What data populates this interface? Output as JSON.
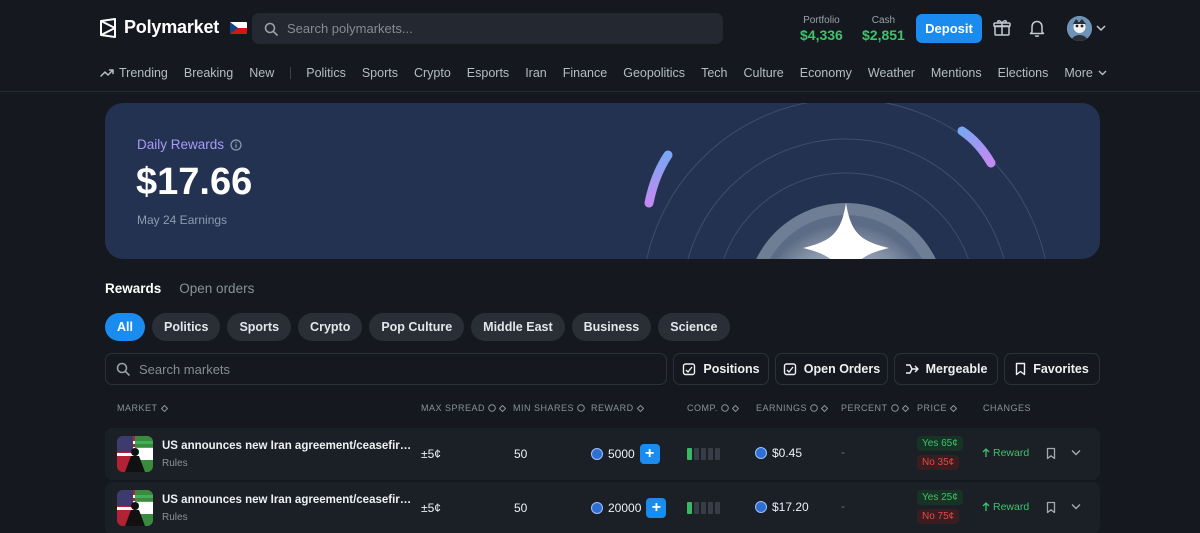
{
  "header": {
    "brand": "Polymarket",
    "search_placeholder": "Search polymarkets...",
    "portfolio_label": "Portfolio",
    "portfolio_value": "$4,336",
    "cash_label": "Cash",
    "cash_value": "$2,851",
    "deposit_label": "Deposit",
    "icons": [
      "polymarket-logo-icon",
      "czech-flag-icon",
      "search-icon",
      "gift-icon",
      "bell-icon",
      "avatar",
      "chevron-down-icon"
    ]
  },
  "nav": {
    "items": [
      "Trending",
      "Breaking",
      "New",
      "Politics",
      "Sports",
      "Crypto",
      "Esports",
      "Iran",
      "Finance",
      "Geopolitics",
      "Tech",
      "Culture",
      "Economy",
      "Weather",
      "Mentions",
      "Elections",
      "More"
    ]
  },
  "banner": {
    "title": "Daily Rewards",
    "amount": "$17.66",
    "subtitle": "May 24 Earnings"
  },
  "tabs": [
    "Rewards",
    "Open orders"
  ],
  "filters": [
    "All",
    "Politics",
    "Sports",
    "Crypto",
    "Pop Culture",
    "Middle East",
    "Business",
    "Science"
  ],
  "toolbar": {
    "search_placeholder": "Search markets",
    "positions": "Positions",
    "open_orders": "Open Orders",
    "mergeable": "Mergeable",
    "favorites": "Favorites"
  },
  "table": {
    "columns": [
      "MARKET",
      "MAX SPREAD",
      "MIN SHARES",
      "REWARD",
      "COMP.",
      "EARNINGS",
      "PERCENT",
      "PRICE",
      "CHANGES"
    ],
    "rows": [
      {
        "title": "US announces new Iran agreement/ceasefire ext...",
        "rules": "Rules",
        "max_spread": "±5¢",
        "min_shares": "50",
        "reward": "5000",
        "comp_level": 1,
        "earnings": "$0.45",
        "percent": "-",
        "yes": "Yes 65¢",
        "no": "No 35¢",
        "change": "Reward"
      },
      {
        "title": "US announces new Iran agreement/ceasefire ext...",
        "rules": "Rules",
        "max_spread": "±5¢",
        "min_shares": "50",
        "reward": "20000",
        "comp_level": 1,
        "earnings": "$17.20",
        "percent": "-",
        "yes": "Yes 25¢",
        "no": "No 75¢",
        "change": "Reward"
      }
    ]
  },
  "colors": {
    "accent": "#1a8cf0",
    "positive": "#3ec26a",
    "negative": "#e54848",
    "banner": "#233250",
    "rewards_purple": "#a89af6"
  }
}
